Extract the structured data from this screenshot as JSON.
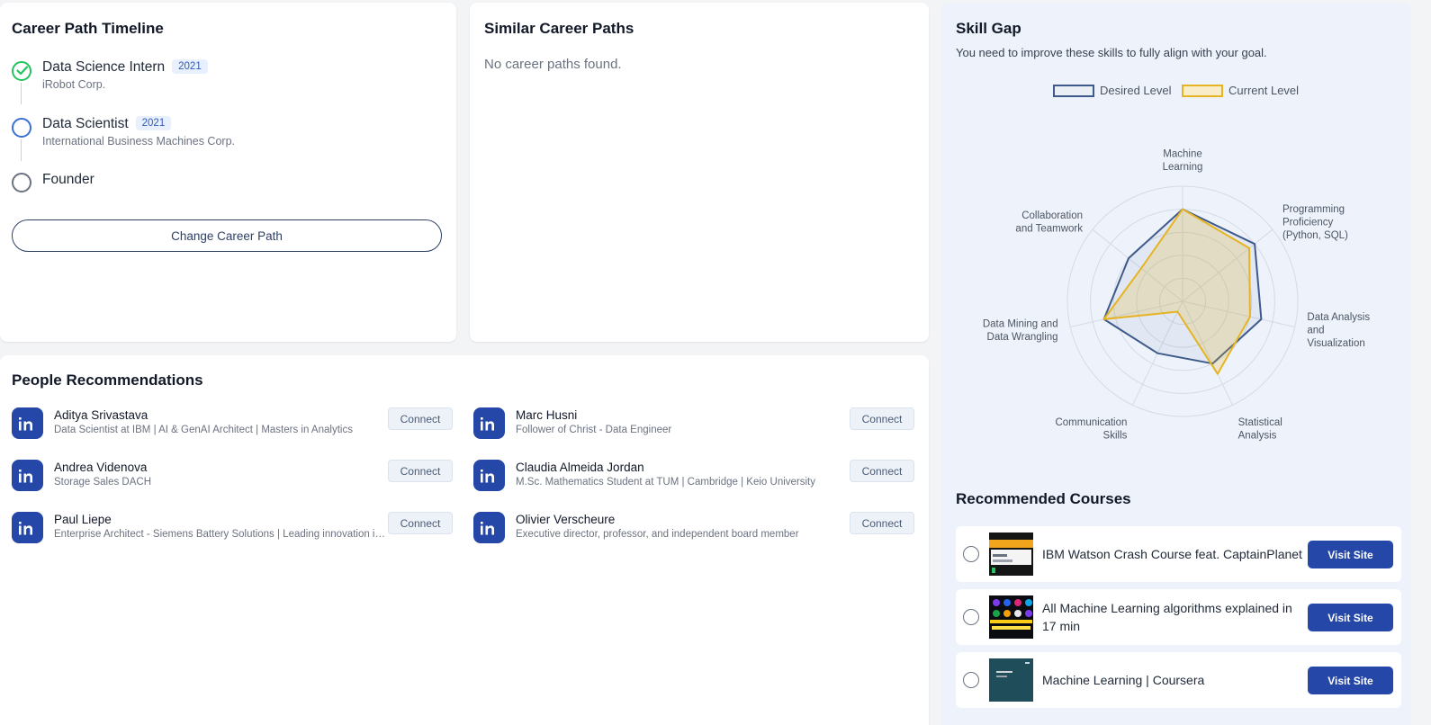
{
  "timeline": {
    "title": "Career Path Timeline",
    "items": [
      {
        "role": "Data Science Intern",
        "year": "2021",
        "company": "iRobot Corp.",
        "status": "completed"
      },
      {
        "role": "Data Scientist",
        "year": "2021",
        "company": "International Business Machines Corp.",
        "status": "current"
      },
      {
        "role": "Founder",
        "year": "",
        "company": "",
        "status": "future"
      }
    ],
    "change_button": "Change Career Path"
  },
  "similar": {
    "title": "Similar Career Paths",
    "empty_text": "No career paths found."
  },
  "people": {
    "title": "People Recommendations",
    "connect_label": "Connect",
    "items": [
      {
        "name": "Aditya Srivastava",
        "headline": "Data Scientist at IBM | AI & GenAI Architect | Masters in Analytics"
      },
      {
        "name": "Marc Husni",
        "headline": "Follower of Christ - Data Engineer"
      },
      {
        "name": "Andrea Videnova",
        "headline": "Storage Sales DACH"
      },
      {
        "name": "Claudia Almeida Jordan",
        "headline": "M.Sc. Mathematics Student at TUM | Cambridge | Keio University"
      },
      {
        "name": "Paul Liepe",
        "headline": "Enterprise Architect - Siemens Battery Solutions | Leading innovation in battery technology"
      },
      {
        "name": "Olivier Verscheure",
        "headline": "Executive director, professor, and independent board member"
      }
    ]
  },
  "skill_gap": {
    "title": "Skill Gap",
    "subtitle": "You need to improve these skills to fully align with your goal.",
    "legend": {
      "desired": "Desired Level",
      "current": "Current Level"
    },
    "colors": {
      "desired": "#3d5a8a",
      "current": "#e6b422"
    }
  },
  "chart_data": {
    "type": "radar",
    "axes": [
      [
        "Machine",
        "Learning"
      ],
      [
        "Programming",
        "Proficiency",
        "(Python, SQL)"
      ],
      [
        "Data Analysis",
        "and",
        "Visualization"
      ],
      [
        "Statistical",
        "Analysis"
      ],
      [
        "Communication",
        "Skills"
      ],
      [
        "Data Mining and",
        "Data Wrangling"
      ],
      [
        "Collaboration",
        "and Teamwork"
      ]
    ],
    "rmax": 5,
    "series": [
      {
        "name": "Desired Level",
        "values": [
          4,
          4,
          3.5,
          3,
          2.5,
          3.5,
          3
        ]
      },
      {
        "name": "Current Level",
        "values": [
          4,
          3.7,
          3,
          3.5,
          0.5,
          3.5,
          2.3
        ]
      }
    ]
  },
  "courses": {
    "title": "Recommended Courses",
    "visit_label": "Visit Site",
    "items": [
      {
        "title": "IBM Watson Crash Course feat. CaptainPlanet"
      },
      {
        "title": "All Machine Learning algorithms explained in 17 min"
      },
      {
        "title": "Machine Learning | Coursera"
      }
    ]
  }
}
